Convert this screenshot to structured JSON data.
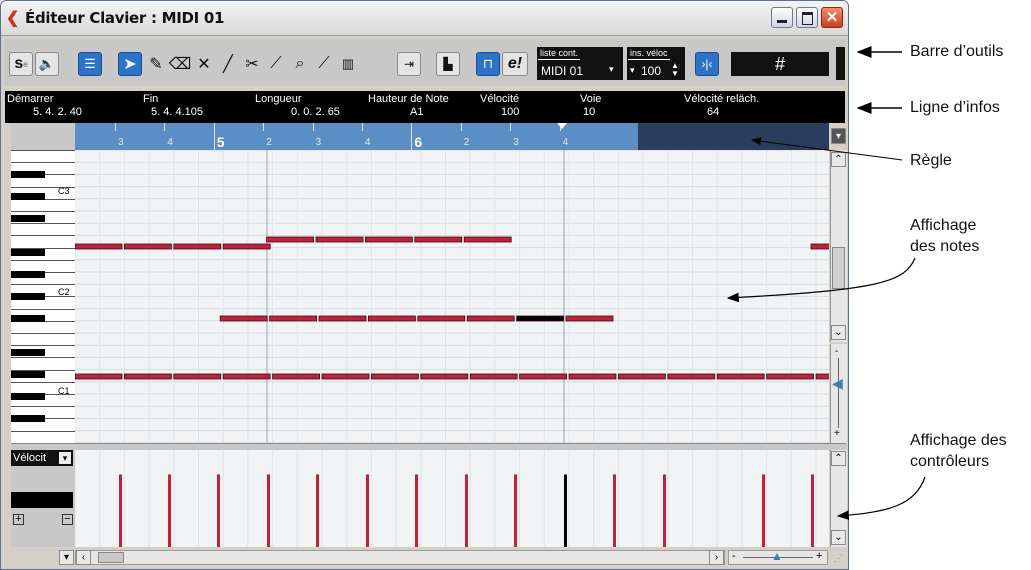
{
  "window": {
    "title": "Éditeur Clavier : MIDI 01"
  },
  "toolbar": {
    "cont_list_label": "liste cont.",
    "cont_list_value": "MIDI 01",
    "vel_label": "ins. véloc",
    "vel_value": "100",
    "quantize_symbol": "#",
    "edit_e": "e!",
    "solo_s": "s"
  },
  "infoline": {
    "fields": [
      {
        "label": "Démarrer",
        "value": "5. 4. 2. 40"
      },
      {
        "label": "Fin",
        "value": "5. 4. 4.105"
      },
      {
        "label": "Longueur",
        "value": "0. 0. 2. 65"
      },
      {
        "label": "Hauteur de Note",
        "value": "A1"
      },
      {
        "label": "Vélocité",
        "value": "100"
      },
      {
        "label": "Voie",
        "value": "10"
      },
      {
        "label": "Vélocité reläch.",
        "value": "64"
      }
    ]
  },
  "ruler": {
    "bars": [
      {
        "label": "3",
        "major": false
      },
      {
        "label": "4",
        "major": false
      },
      {
        "label": "5",
        "major": true
      },
      {
        "label": "2",
        "major": false
      },
      {
        "label": "3",
        "major": false
      },
      {
        "label": "4",
        "major": false
      },
      {
        "label": "6",
        "major": true
      },
      {
        "label": "2",
        "major": false
      },
      {
        "label": "3",
        "major": false
      },
      {
        "label": "4",
        "major": false
      }
    ]
  },
  "keyboard": {
    "octave_labels": [
      "C3",
      "C2",
      "C1"
    ]
  },
  "controller": {
    "lane_select": "Vélocit",
    "velocities": [
      100,
      100,
      100,
      100,
      100,
      100,
      100,
      100,
      100,
      100,
      100,
      100,
      100,
      100,
      100
    ]
  },
  "annotations": {
    "toolbar": "Barre d’outils",
    "infoline": "Ligne d’infos",
    "ruler": "Règle",
    "notes": [
      "Affichage",
      "des notes"
    ],
    "controllers": [
      "Affichage des",
      "contrôleurs"
    ]
  },
  "colors": {
    "note": "#c0223e",
    "selected_note": "#000000",
    "ruler": "#5b8ec4",
    "ruler_dark": "#2a3d5c",
    "toolbar_active": "#2c73c8"
  }
}
